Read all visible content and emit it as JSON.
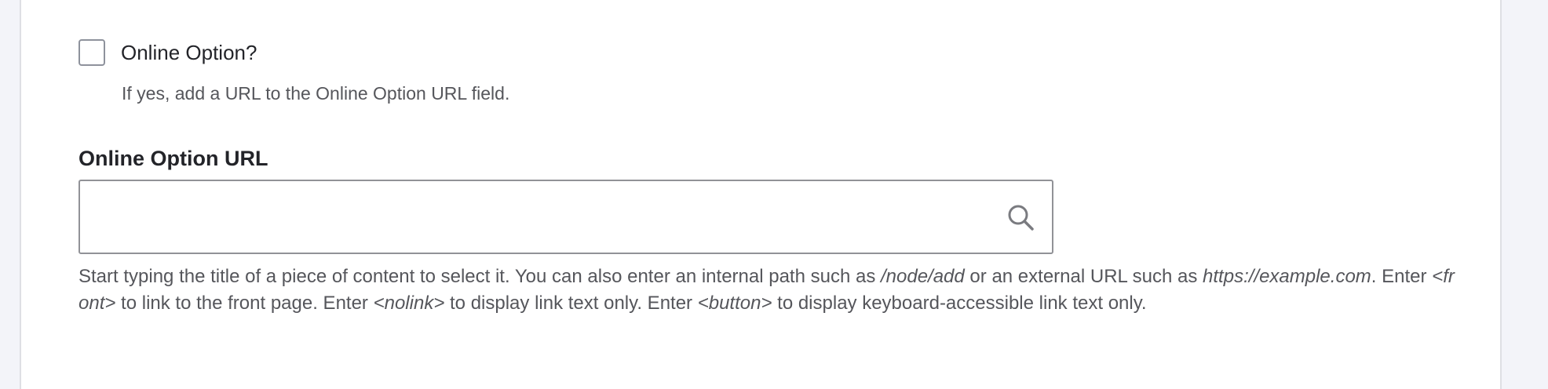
{
  "online_option": {
    "checkbox_label": "Online Option?",
    "checked": false,
    "description": "If yes, add a URL to the Online Option URL field."
  },
  "online_option_url": {
    "label": "Online Option URL",
    "value": "",
    "placeholder": "",
    "icon": "search-icon",
    "help": {
      "part1": "Start typing the title of a piece of content to select it. You can also enter an internal path such as ",
      "node_add": "/node/add",
      "part2": " or an external URL such as ",
      "example_url": "https://example.com",
      "part3": ". Enter ",
      "front": "<front>",
      "part4": " to link to the front page. Enter ",
      "nolink": "<nolink>",
      "part5": " to display link text only. Enter ",
      "button": "<button>",
      "part6": " to display keyboard-accessible link text only."
    }
  }
}
